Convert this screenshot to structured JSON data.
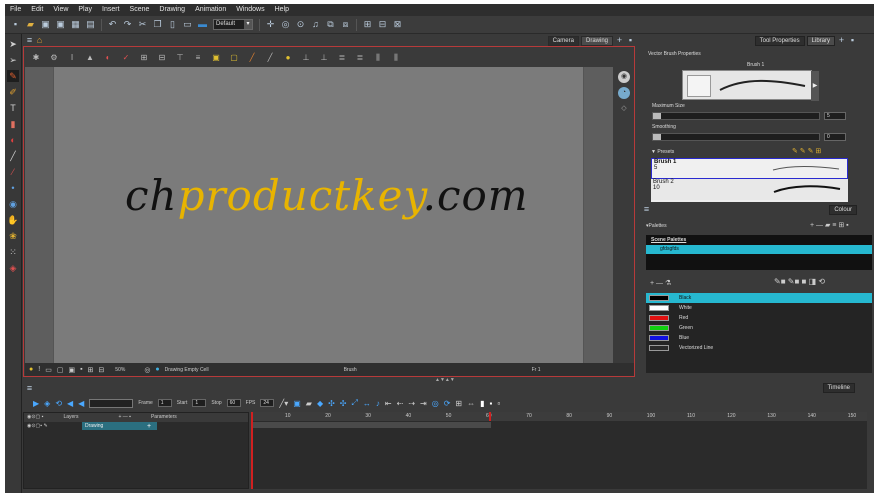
{
  "menu": [
    "File",
    "Edit",
    "View",
    "Play",
    "Insert",
    "Scene",
    "Drawing",
    "Animation",
    "Windows",
    "Help"
  ],
  "toolbar": {
    "workspace": "Default"
  },
  "view": {
    "tabs": [
      "Camera",
      "Drawing"
    ],
    "watermark_dark1": "ch",
    "watermark_gold1": "productkey",
    "watermark_dark2": ".com",
    "status": {
      "zoom": "50%",
      "drawing": "Drawing Empty Cell",
      "tool": "Brush",
      "frame": "Fr 1"
    }
  },
  "tool_properties": {
    "tabs": [
      "Tool Properties",
      "Library"
    ],
    "title": "Vector Brush Properties",
    "brush_name": "Brush 1",
    "max_size_label": "Maximum Size",
    "max_size_value": "5",
    "smoothing_label": "Smoothing",
    "smoothing_value": "0",
    "presets_label": "Presets",
    "presets": [
      {
        "name": "Brush 1",
        "size": "5"
      },
      {
        "name": "Brush 2",
        "size": "10"
      }
    ]
  },
  "colour_panel": {
    "tab": "Colour",
    "palettes_label": "Palettes",
    "scene_palettes_label": "Scene Palettes",
    "palette": "gfdsgfds",
    "colours": [
      {
        "name": "Black",
        "hex": "#000000"
      },
      {
        "name": "White",
        "hex": "#ffffff"
      },
      {
        "name": "Red",
        "hex": "#e01010"
      },
      {
        "name": "Green",
        "hex": "#10d010"
      },
      {
        "name": "Blue",
        "hex": "#1010e0"
      },
      {
        "name": "Vectorized Line",
        "hex": "#2a2a2a"
      }
    ]
  },
  "timeline": {
    "tab": "Timeline",
    "frame_label": "Frame",
    "frame_value": "1",
    "start_label": "Start",
    "start_value": "1",
    "stop_label": "Stop",
    "stop_value": "60",
    "fps_label": "FPS",
    "fps_value": "24",
    "layers_header": "Layers",
    "parameters_header": "Parameters",
    "layer_name": "Drawing",
    "ruler": [
      "10",
      "20",
      "30",
      "40",
      "50",
      "60",
      "70",
      "80",
      "90",
      "100",
      "110",
      "120",
      "130",
      "140",
      "150"
    ]
  }
}
